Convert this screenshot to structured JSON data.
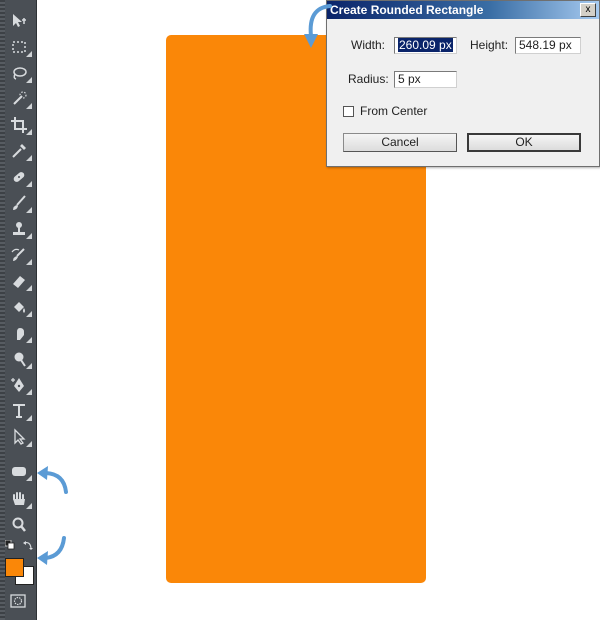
{
  "dialog": {
    "title": "Create Rounded Rectangle",
    "close_label": "x",
    "width_label": "Width:",
    "width_value": "260.09 px",
    "height_label": "Height:",
    "height_value": "548.19 px",
    "radius_label": "Radius:",
    "radius_value": "5 px",
    "from_center_label": "From Center",
    "from_center_checked": false,
    "cancel_label": "Cancel",
    "ok_label": "OK"
  },
  "toolbar": {
    "tools": [
      "move-tool-icon",
      "marquee-tool-icon",
      "lasso-tool-icon",
      "quick-selection-tool-icon",
      "crop-tool-icon",
      "eyedropper-tool-icon",
      "spot-healing-tool-icon",
      "brush-tool-icon",
      "clone-stamp-tool-icon",
      "history-brush-tool-icon",
      "eraser-tool-icon",
      "paint-bucket-tool-icon",
      "smudge-tool-icon",
      "dodge-tool-icon",
      "pen-tool-icon",
      "type-tool-icon",
      "path-selection-tool-icon",
      "rounded-rectangle-tool-icon",
      "hand-tool-icon",
      "zoom-tool-icon"
    ],
    "foreground_color": "#fa8708",
    "background_color": "#ffffff"
  },
  "canvas": {
    "shape_color": "#fa8708"
  },
  "colors": {
    "accent_arrow": "#5b9bd5",
    "toolbar_bg": "#4a4f55"
  }
}
